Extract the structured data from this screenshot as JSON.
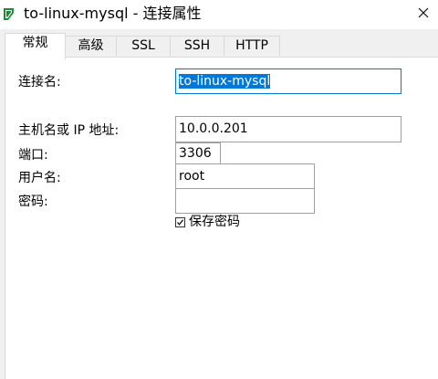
{
  "window": {
    "title": "to-linux-mysql - 连接属性",
    "close_glyph": "✕"
  },
  "tabs": [
    {
      "label": "常规",
      "active": true
    },
    {
      "label": "高级",
      "active": false
    },
    {
      "label": "SSL",
      "active": false
    },
    {
      "label": "SSH",
      "active": false
    },
    {
      "label": "HTTP",
      "active": false
    }
  ],
  "form": {
    "connection_name_label": "连接名:",
    "connection_name_value": "to-linux-mysql",
    "host_label": "主机名或 IP 地址:",
    "host_value": "10.0.0.201",
    "port_label": "端口:",
    "port_value": "3306",
    "username_label": "用户名:",
    "username_value": "root",
    "password_label": "密码:",
    "password_value": "",
    "save_password_label": "保存密码",
    "save_password_checked": true
  },
  "colors": {
    "accent": "#0078d7",
    "app_icon": "#1e8a3c"
  },
  "icons": {
    "app": "navicat-app-icon",
    "close": "close-icon",
    "check": "checkmark-icon"
  }
}
